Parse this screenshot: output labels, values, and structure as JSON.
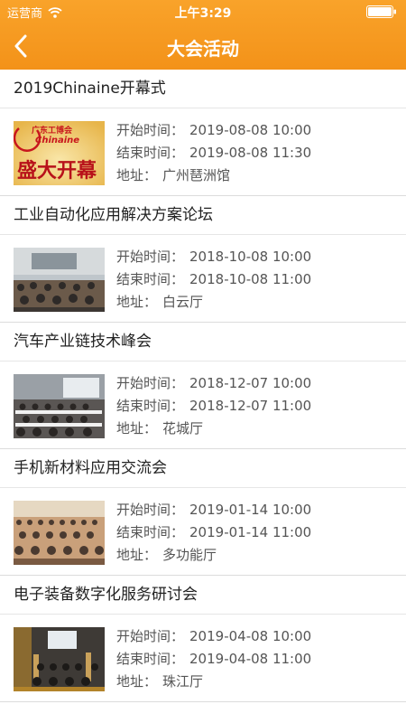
{
  "status_bar": {
    "carrier": "运营商",
    "time": "上午3:29"
  },
  "nav": {
    "title": "大会活动"
  },
  "labels": {
    "start": "开始时间：",
    "end": "结束时间：",
    "location": "地址："
  },
  "events": [
    {
      "title": "2019Chinaine开幕式",
      "start": "2019-08-08 10:00",
      "end": "2019-08-08 11:30",
      "location": "广州琶洲馆",
      "thumb_text_top": "广东工博会",
      "thumb_text_mid": "Chinaine",
      "thumb_text_big": "盛大开幕"
    },
    {
      "title": "工业自动化应用解决方案论坛",
      "start": "2018-10-08 10:00",
      "end": "2018-10-08 11:00",
      "location": "白云厅"
    },
    {
      "title": "汽车产业链技术峰会",
      "start": "2018-12-07 10:00",
      "end": "2018-12-07 11:00",
      "location": "花城厅"
    },
    {
      "title": "手机新材料应用交流会",
      "start": "2019-01-14 10:00",
      "end": "2019-01-14 11:00",
      "location": "多功能厅"
    },
    {
      "title": "电子装备数字化服务研讨会",
      "start": "2019-04-08 10:00",
      "end": "2019-04-08 11:00",
      "location": "珠江厅"
    }
  ],
  "colors": {
    "header": "#f7a023",
    "accent_red": "#c8161d"
  }
}
